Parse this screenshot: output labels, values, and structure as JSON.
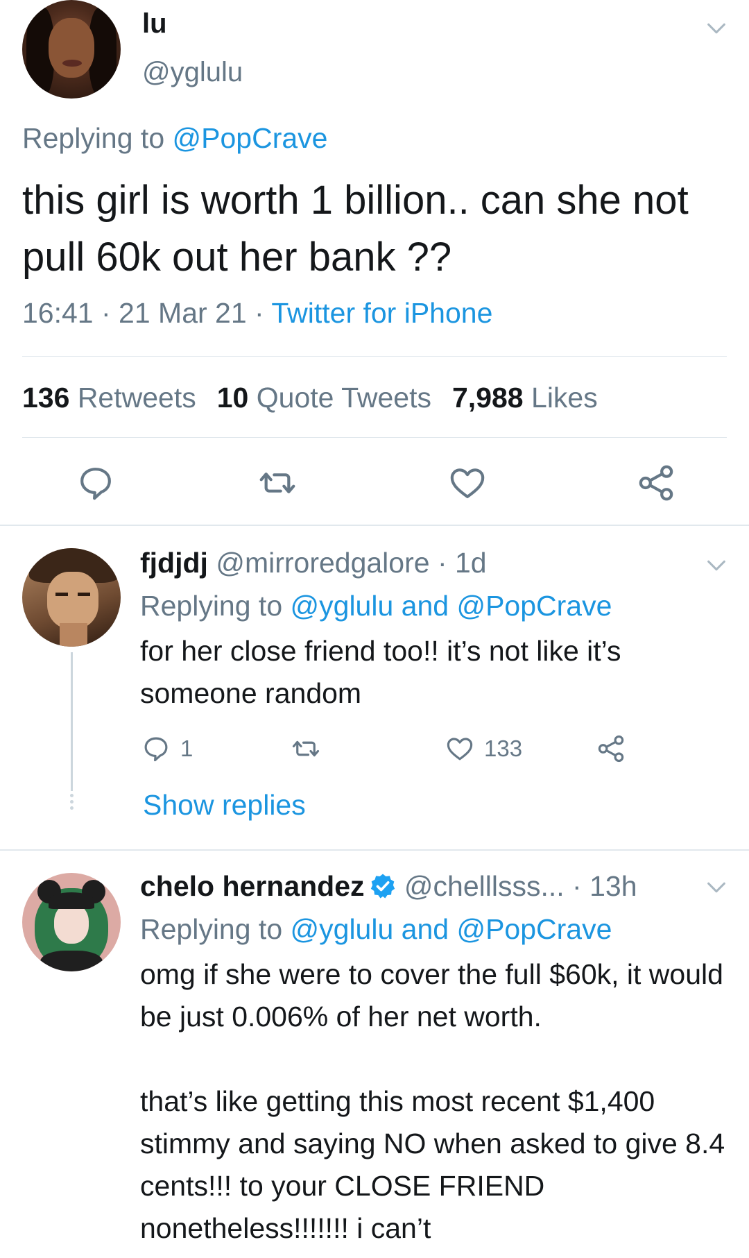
{
  "main_tweet": {
    "display_name": "lu",
    "handle": "@yglulu",
    "replying_label": "Replying to ",
    "replying_to": "@PopCrave",
    "text": "this girl is worth 1 billion.. can she not pull 60k out her bank ??",
    "time": "16:41",
    "date": "21 Mar 21",
    "source": "Twitter for iPhone",
    "stats": {
      "retweets_count": "136",
      "retweets_label": "Retweets",
      "quote_count": "10",
      "quote_label": "Quote Tweets",
      "likes_count": "7,988",
      "likes_label": "Likes"
    }
  },
  "replies": [
    {
      "display_name": "fjdjdj",
      "handle": "@mirroredgalore",
      "age": "1d",
      "replying_label": "Replying to ",
      "replying_to": "@yglulu and @PopCrave",
      "text": "for her close friend too!! it’s not like it’s someone random",
      "reply_count": "1",
      "like_count": "133",
      "show_replies": "Show replies"
    },
    {
      "display_name": "chelo hernandez",
      "handle": "@chelllsss...",
      "age": "13h",
      "replying_label": "Replying to ",
      "replying_to": "@yglulu and @PopCrave",
      "text_p1": "omg if she were to cover the full $60k, it would be just 0.006% of her net worth.",
      "text_p2": "that’s like getting this most recent $1,400 stimmy and saying NO when asked to give 8.4 cents!!! to your CLOSE FRIEND nonetheless!!!!!!! i can’t"
    }
  ],
  "colors": {
    "link": "#1b95e0",
    "secondary_text": "#657786",
    "primary_text": "#14171a",
    "divider": "#e1e8ed"
  },
  "icons": [
    "chevron-down-icon",
    "reply-icon",
    "retweet-icon",
    "like-icon",
    "share-icon",
    "verified-badge-icon"
  ]
}
